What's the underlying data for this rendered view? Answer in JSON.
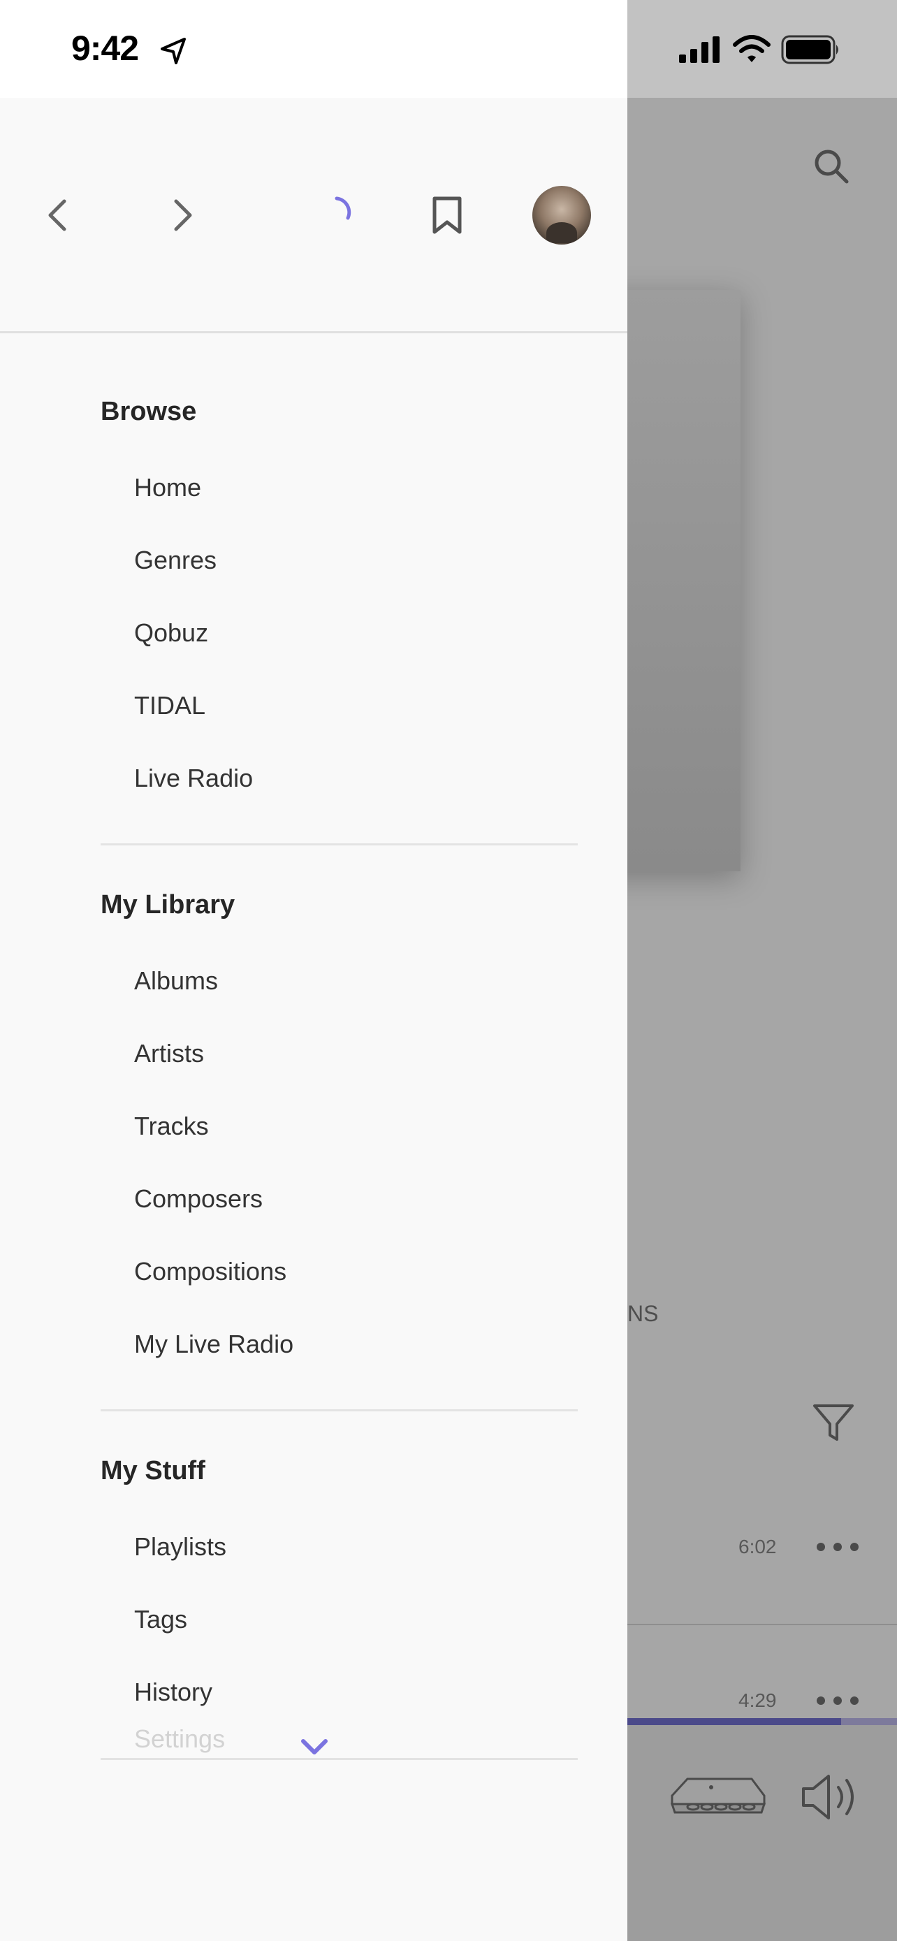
{
  "status_bar": {
    "time": "9:42"
  },
  "drawer": {
    "sections": [
      {
        "title": "Browse",
        "items": [
          "Home",
          "Genres",
          "Qobuz",
          "TIDAL",
          "Live Radio"
        ]
      },
      {
        "title": "My Library",
        "items": [
          "Albums",
          "Artists",
          "Tracks",
          "Composers",
          "Compositions",
          "My Live Radio"
        ]
      },
      {
        "title": "My Stuff",
        "items": [
          "Playlists",
          "Tags",
          "History"
        ]
      }
    ],
    "settings_label": "Settings"
  },
  "background": {
    "partial_text": "NS",
    "track_durations": [
      "6:02",
      "4:29"
    ]
  },
  "colors": {
    "accent": "#7b73e0",
    "drawer_bg": "#f9f9f9",
    "progress": "#4b4a8a"
  },
  "icons": {
    "header": [
      "back-icon",
      "forward-icon",
      "loading-spinner-icon",
      "bookmark-icon",
      "avatar"
    ],
    "background": [
      "search-icon",
      "filter-icon",
      "more-icon",
      "device-icon",
      "volume-icon"
    ]
  }
}
